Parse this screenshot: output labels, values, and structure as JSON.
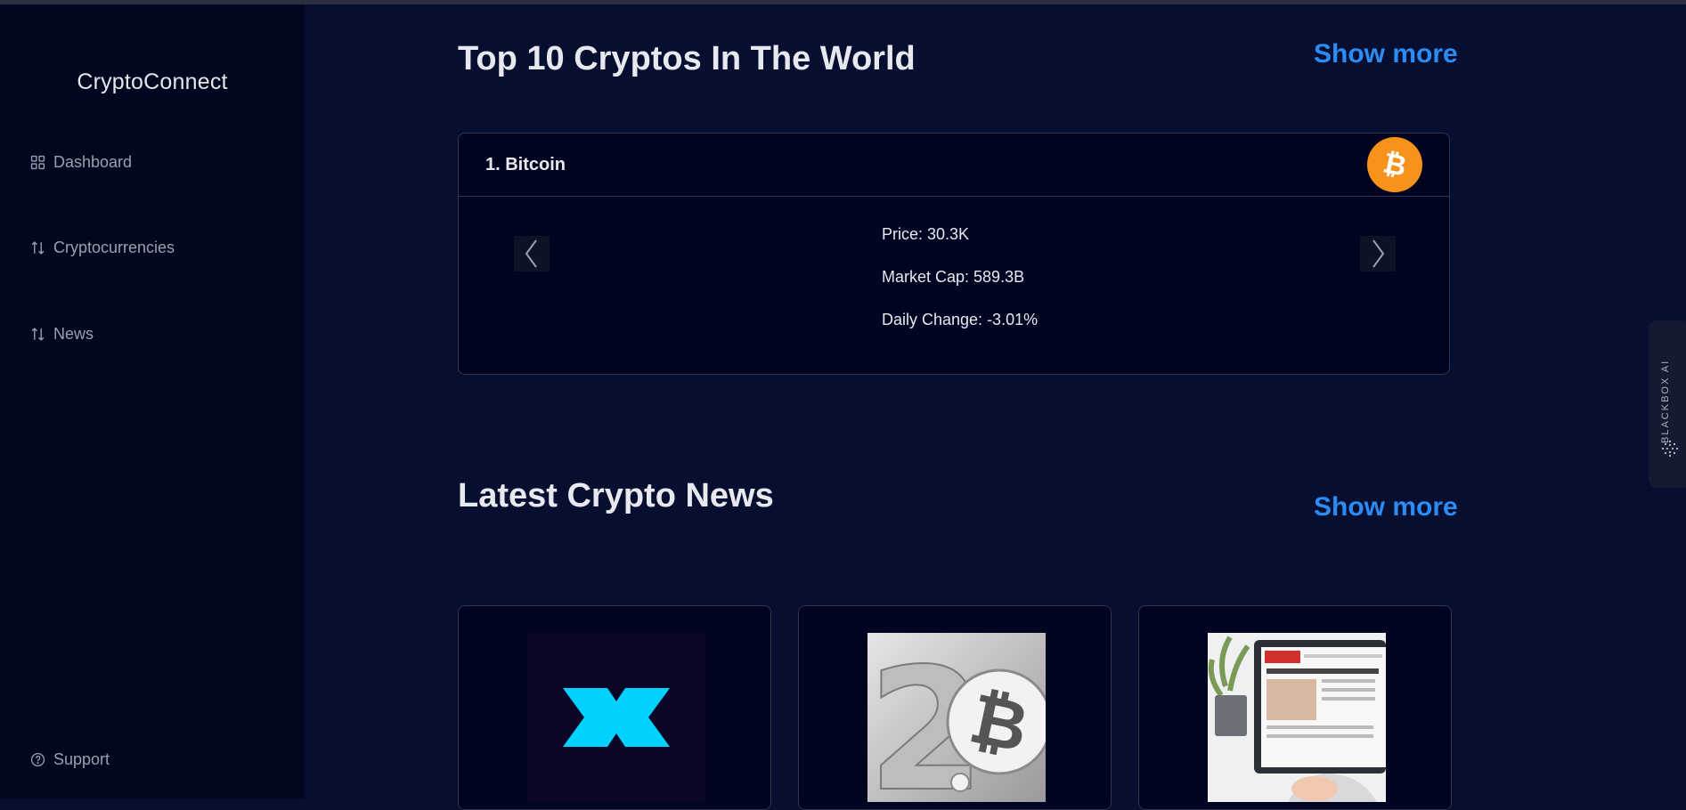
{
  "brand": "CryptoConnect",
  "nav": {
    "items": [
      {
        "label": "Dashboard",
        "icon": "grid-icon"
      },
      {
        "label": "Cryptocurrencies",
        "icon": "sort-arrows-icon"
      },
      {
        "label": "News",
        "icon": "sort-arrows-icon"
      }
    ],
    "support": {
      "label": "Support",
      "icon": "help-circle-icon"
    }
  },
  "top_section": {
    "title": "Top 10 Cryptos In The World",
    "show_more": "Show more"
  },
  "crypto_card": {
    "title": "1. Bitcoin",
    "icon": "bitcoin-icon",
    "icon_color": "#f7931a",
    "price": "Price: 30.3K",
    "market_cap": "Market Cap: 589.3B",
    "daily_change": "Daily Change: -3.01%"
  },
  "news_section": {
    "title": "Latest Crypto News",
    "show_more": "Show more",
    "cards": [
      {
        "image": "synthetix-logo-image"
      },
      {
        "image": "bitcoin-2-0-image"
      },
      {
        "image": "news-laptop-image"
      }
    ]
  },
  "widget": {
    "label": "BLACKBOX AI"
  },
  "colors": {
    "accent": "#2b8cf5",
    "background": "#070f31",
    "sidebar": "#02061f",
    "card": "#000420"
  }
}
